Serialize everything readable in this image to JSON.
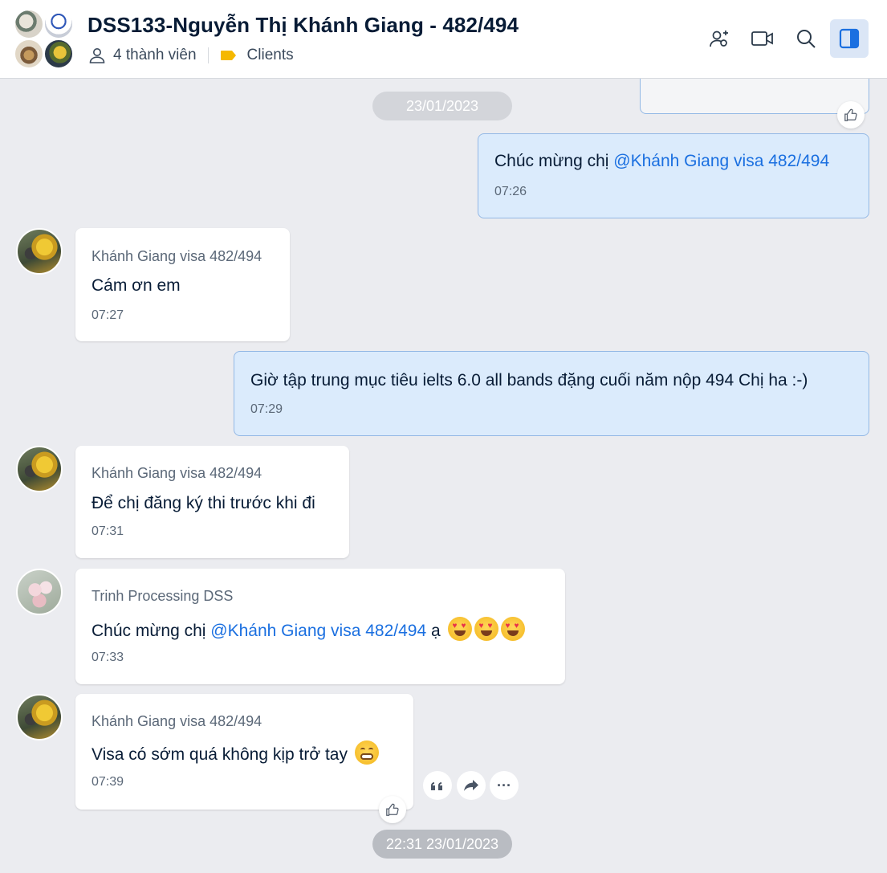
{
  "header": {
    "title": "DSS133-Nguyễn Thị Khánh Giang - 482/494",
    "members": "4 thành viên",
    "label": "Clients",
    "label_color": "#f5b800"
  },
  "messages": [
    {
      "type": "date",
      "text": "23/01/2023"
    },
    {
      "type": "mine",
      "text_prefix": "Chúc mừng chị ",
      "mention": "@Khánh Giang visa 482/494",
      "time": "07:26"
    },
    {
      "type": "theirs",
      "sender": "Khánh Giang visa 482/494",
      "text": "Cám ơn em",
      "time": "07:27"
    },
    {
      "type": "mine",
      "text": "Giờ tập trung mục tiêu  ielts 6.0 all bands đặng cuối năm nộp 494 Chị ha :-)",
      "time": "07:29"
    },
    {
      "type": "theirs",
      "sender": "Khánh Giang visa 482/494",
      "text": "Để chị đăng ký thi trước khi đi",
      "time": "07:31"
    },
    {
      "type": "theirs",
      "sender": "Trinh Processing DSS",
      "text_prefix": "Chúc mừng chị ",
      "mention": "@Khánh Giang visa 482/494",
      "text_suffix": "  ạ",
      "emoji": "heart-eyes ×3",
      "time": "07:33"
    },
    {
      "type": "theirs",
      "sender": "Khánh Giang visa 482/494",
      "text": "Visa có sớm quá không kịp trở tay",
      "emoji": "grimacing",
      "time": "07:39"
    },
    {
      "type": "date",
      "text": "22:31 23/01/2023"
    }
  ],
  "actions": {
    "quote": "quote",
    "forward": "forward",
    "more": "···"
  },
  "colors": {
    "accent": "#1a6fe0",
    "mine_bubble": "#dbebfc",
    "mine_border": "#93b8e5",
    "background": "#ebecf0"
  }
}
